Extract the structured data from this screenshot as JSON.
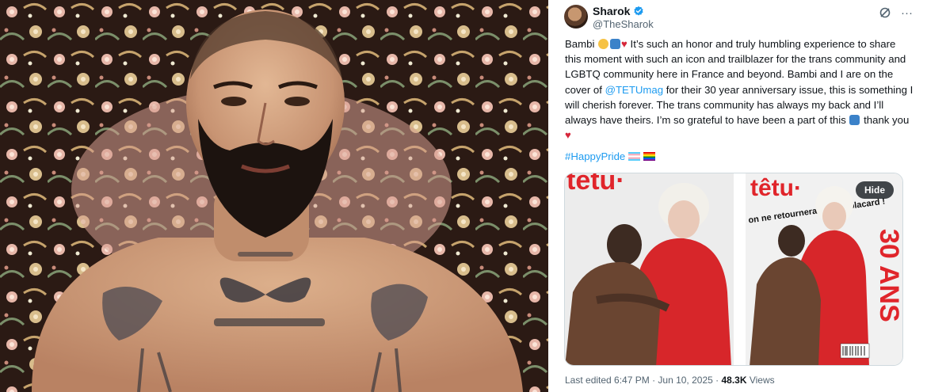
{
  "tweet": {
    "name": "Sharok",
    "handle": "@TheSharok",
    "body_part1": "Bambi ",
    "body_part2": " It’s such an honor and truly humbling experience to share this moment with such an icon and trailblazer for the trans community and LGBTQ community here in France and beyond. Bambi and I are on the cover of ",
    "mention": "@TETUmag",
    "body_part3": " for their 30 year anniversary issue, this is something I will cherish forever. The trans community has always my back and I’ll always have theirs. I’m so grateful to have been a part of this ",
    "body_part4": " thank you ",
    "hashtag": "#HappyPride",
    "hide_label": "Hide",
    "edited_label": "Last edited 6:47 PM · Jun 10, 2025 · ",
    "views_count": "48.3K",
    "views_label": " Views"
  },
  "media": {
    "cover1_masthead": "têtu·",
    "cover2_masthead": "têtu·",
    "cover2_tagline": "on ne retournera pas au placard !",
    "cover2_big": "30 ANS"
  },
  "colors": {
    "accent": "#1d9bf0",
    "heart": "#d6263a",
    "tetu_red": "#e0252b"
  },
  "icons": [
    "verified-badge-icon",
    "grok-icon",
    "more-icon",
    "heart-icon",
    "trans-flag-icon",
    "pride-flag-icon"
  ]
}
